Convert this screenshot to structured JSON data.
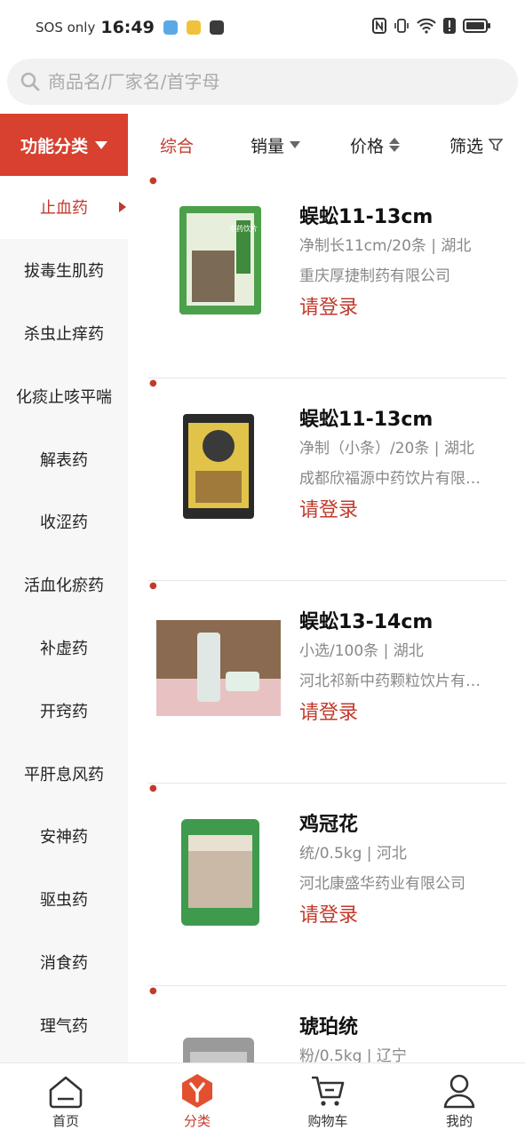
{
  "status_bar": {
    "sos": "SOS only",
    "time": "16:49",
    "icons": [
      "nfc-icon",
      "vibrate-icon",
      "wifi-icon",
      "alert-icon",
      "battery-icon"
    ]
  },
  "search": {
    "placeholder": "商品名/厂家名/首字母",
    "value": ""
  },
  "category_header": {
    "label": "功能分类"
  },
  "sort_bar": {
    "comprehensive": "综合",
    "sales": "销量",
    "price": "价格",
    "filter": "筛选"
  },
  "sidebar": {
    "items": [
      {
        "label": "止血药",
        "active": true
      },
      {
        "label": "拔毒生肌药"
      },
      {
        "label": "杀虫止痒药"
      },
      {
        "label": "化痰止咳平喘"
      },
      {
        "label": "解表药"
      },
      {
        "label": "收涩药"
      },
      {
        "label": "活血化瘀药"
      },
      {
        "label": "补虚药"
      },
      {
        "label": "开窍药"
      },
      {
        "label": "平肝息风药"
      },
      {
        "label": "安神药"
      },
      {
        "label": "驱虫药"
      },
      {
        "label": "消食药"
      },
      {
        "label": "理气药"
      }
    ]
  },
  "products": [
    {
      "name": "蜈蚣11-13cm",
      "spec": "净制长11cm/20条 | 湖北",
      "maker": "重庆厚捷制药有限公司",
      "price": "请登录",
      "package_text": "中药饮片"
    },
    {
      "name": "蜈蚣11-13cm",
      "spec": "净制（小条）/20条 | 湖北",
      "maker": "成都欣福源中药饮片有限公司",
      "price": "请登录"
    },
    {
      "name": "蜈蚣13-14cm",
      "spec": "小选/100条 | 湖北",
      "maker": "河北祁新中药颗粒饮片有限公司",
      "price": "请登录"
    },
    {
      "name": "鸡冠花",
      "spec": "统/0.5kg | 河北",
      "maker": "河北康盛华药业有限公司",
      "price": "请登录"
    },
    {
      "name": "琥珀统",
      "spec": "粉/0.5kg | 辽宁",
      "maker": "",
      "price": ""
    }
  ],
  "bottom_nav": {
    "home": "首页",
    "category": "分类",
    "cart": "购物车",
    "mine": "我的"
  },
  "colors": {
    "accent": "#d8402f",
    "price": "#c23a2b"
  }
}
